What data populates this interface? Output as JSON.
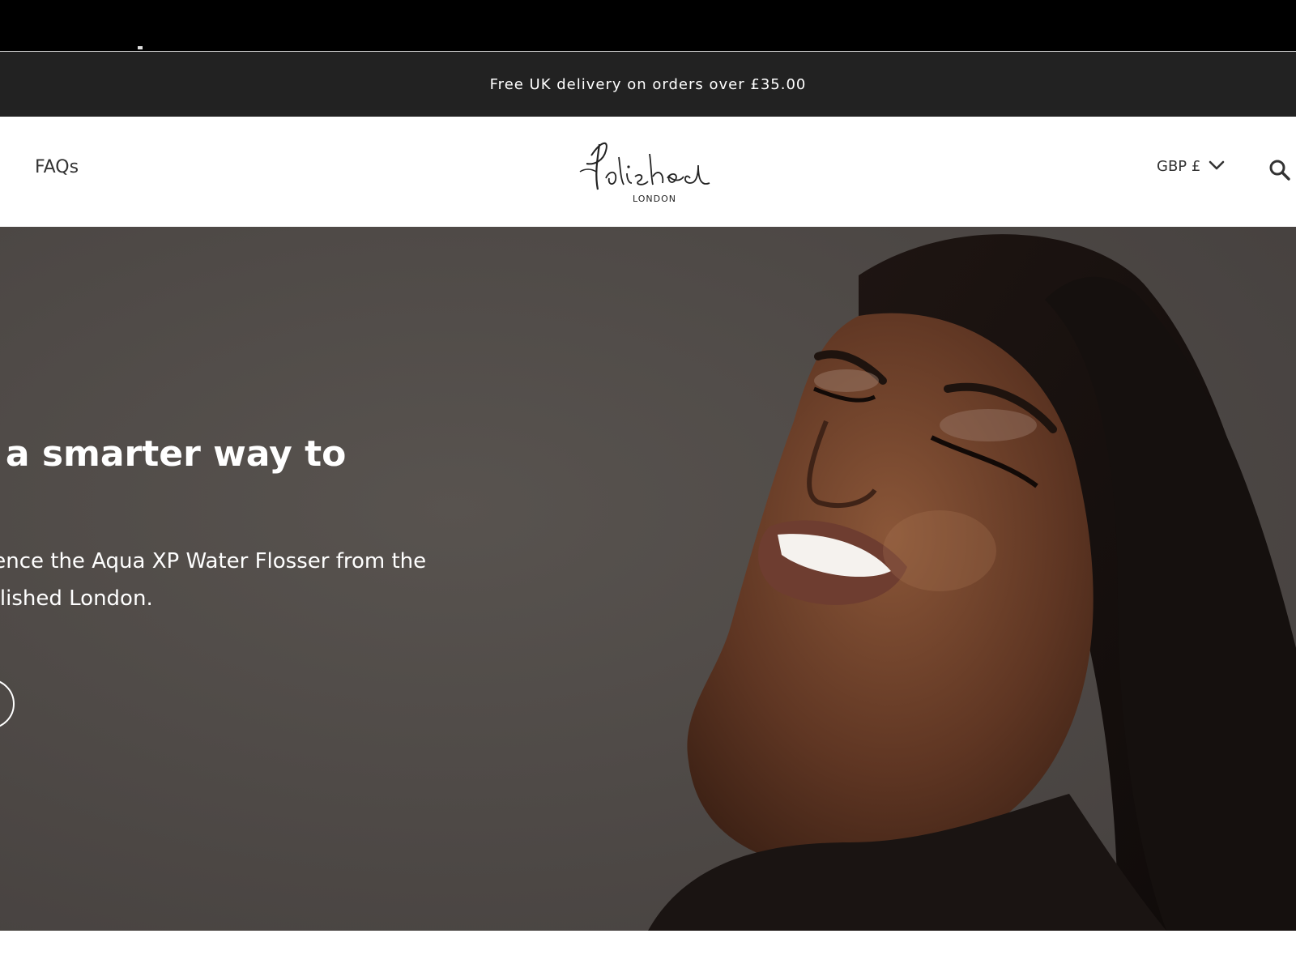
{
  "announcement": {
    "text": "Free UK delivery on orders over £35.00"
  },
  "header": {
    "nav_faqs_label": "FAQs",
    "logo": {
      "script_text": "Polished",
      "sub_text": "LONDON"
    },
    "currency": {
      "selected": "GBP £",
      "icon": "chevron-down-icon"
    },
    "search_icon": "search-icon"
  },
  "hero": {
    "heading": "g a smarter way to",
    "body_lines": [
      "ience the Aqua XP Water Flosser from the",
      "olished London."
    ],
    "colors": {
      "background": "#524d4f",
      "text": "#ffffff"
    }
  },
  "colors": {
    "top_bar": "#000000",
    "announcement_bar": "#222222",
    "header_bg": "#ffffff",
    "nav_text": "#333333"
  }
}
